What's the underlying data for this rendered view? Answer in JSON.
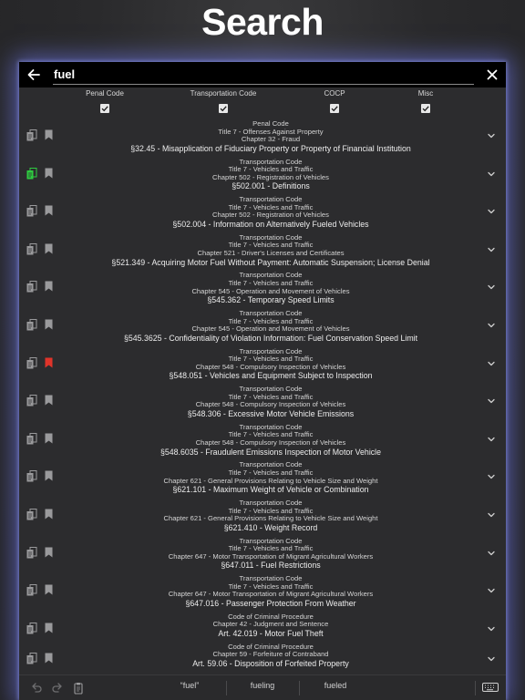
{
  "headline": "Search",
  "search": {
    "value": "fuel"
  },
  "filters": [
    {
      "label": "Penal Code",
      "checked": true
    },
    {
      "label": "Transportation Code",
      "checked": true
    },
    {
      "label": "COCP",
      "checked": true
    },
    {
      "label": "Misc",
      "checked": true
    }
  ],
  "colors": {
    "accent": "#2ecc40",
    "bookmark_active": "#e0342a",
    "glow": "#7b85ff"
  },
  "results": [
    {
      "code": "Penal Code",
      "lines": [
        "Title 7 - Offenses Against Property",
        "Chapter 32 - Fraud"
      ],
      "section": "§32.45 - Misapplication of Fiduciary Property or Property of Financial Institution",
      "highlight": false,
      "bookmarked": false
    },
    {
      "code": "Transportation Code",
      "lines": [
        "Title 7 - Vehicles and Traffic",
        "Chapter 502 - Registration of Vehicles"
      ],
      "section": "§502.001 - Definitions",
      "highlight": true,
      "bookmarked": false
    },
    {
      "code": "Transportation Code",
      "lines": [
        "Title 7 - Vehicles and Traffic",
        "Chapter 502 - Registration of Vehicles"
      ],
      "section": "§502.004 - Information on Alternatively Fueled Vehicles",
      "highlight": false,
      "bookmarked": false
    },
    {
      "code": "Transportation Code",
      "lines": [
        "Title 7 - Vehicles and Traffic",
        "Chapter 521 - Driver's Licenses and Certificates"
      ],
      "section": "§521.349 - Acquiring Motor Fuel Without Payment: Automatic Suspension; License Denial",
      "highlight": false,
      "bookmarked": false
    },
    {
      "code": "Transportation Code",
      "lines": [
        "Title 7 - Vehicles and Traffic",
        "Chapter 545 - Operation and Movement of Vehicles"
      ],
      "section": "§545.362 - Temporary Speed Limits",
      "highlight": false,
      "bookmarked": false
    },
    {
      "code": "Transportation Code",
      "lines": [
        "Title 7 - Vehicles and Traffic",
        "Chapter 545 - Operation and Movement of Vehicles"
      ],
      "section": "§545.3625 - Confidentiality of Violation Information: Fuel Conservation Speed Limit",
      "highlight": false,
      "bookmarked": false
    },
    {
      "code": "Transportation Code",
      "lines": [
        "Title 7 - Vehicles and Traffic",
        "Chapter 548 - Compulsory Inspection of Vehicles"
      ],
      "section": "§548.051 - Vehicles and Equipment Subject to Inspection",
      "highlight": false,
      "bookmarked": true
    },
    {
      "code": "Transportation Code",
      "lines": [
        "Title 7 - Vehicles and Traffic",
        "Chapter 548 - Compulsory Inspection of Vehicles"
      ],
      "section": "§548.306 - Excessive Motor Vehicle Emissions",
      "highlight": false,
      "bookmarked": false
    },
    {
      "code": "Transportation Code",
      "lines": [
        "Title 7 - Vehicles and Traffic",
        "Chapter 548 - Compulsory Inspection of Vehicles"
      ],
      "section": "§548.6035 - Fraudulent Emissions Inspection of Motor Vehicle",
      "highlight": false,
      "bookmarked": false
    },
    {
      "code": "Transportation Code",
      "lines": [
        "Title 7 - Vehicles and Traffic",
        "Chapter 621 - General Provisions Relating to Vehicle Size and Weight"
      ],
      "section": "§621.101 - Maximum Weight of Vehicle or Combination",
      "highlight": false,
      "bookmarked": false
    },
    {
      "code": "Transportation Code",
      "lines": [
        "Title 7 - Vehicles and Traffic",
        "Chapter 621 - General Provisions Relating to Vehicle Size and Weight"
      ],
      "section": "§621.410 - Weight Record",
      "highlight": false,
      "bookmarked": false
    },
    {
      "code": "Transportation Code",
      "lines": [
        "Title 7 - Vehicles and Traffic",
        "Chapter 647 - Motor Transportation of Migrant Agricultural Workers"
      ],
      "section": "§647.011 - Fuel Restrictions",
      "highlight": false,
      "bookmarked": false
    },
    {
      "code": "Transportation Code",
      "lines": [
        "Title 7 - Vehicles and Traffic",
        "Chapter 647 - Motor Transportation of Migrant Agricultural Workers"
      ],
      "section": "§647.016 - Passenger Protection From Weather",
      "highlight": false,
      "bookmarked": false
    },
    {
      "code": "Code of Criminal Procedure",
      "lines": [
        "Chapter 42 - Judgment and Sentence"
      ],
      "section": "Art. 42.019 - Motor Fuel Theft",
      "highlight": false,
      "bookmarked": false
    },
    {
      "code": "Code of Criminal Procedure",
      "lines": [
        "Chapter 59 - Forfeiture of Contraband"
      ],
      "section": "Art. 59.06 - Disposition of Forfeited Property",
      "highlight": false,
      "bookmarked": false
    }
  ],
  "suggestions": [
    "“fuel”",
    "fueling",
    "fueled"
  ]
}
